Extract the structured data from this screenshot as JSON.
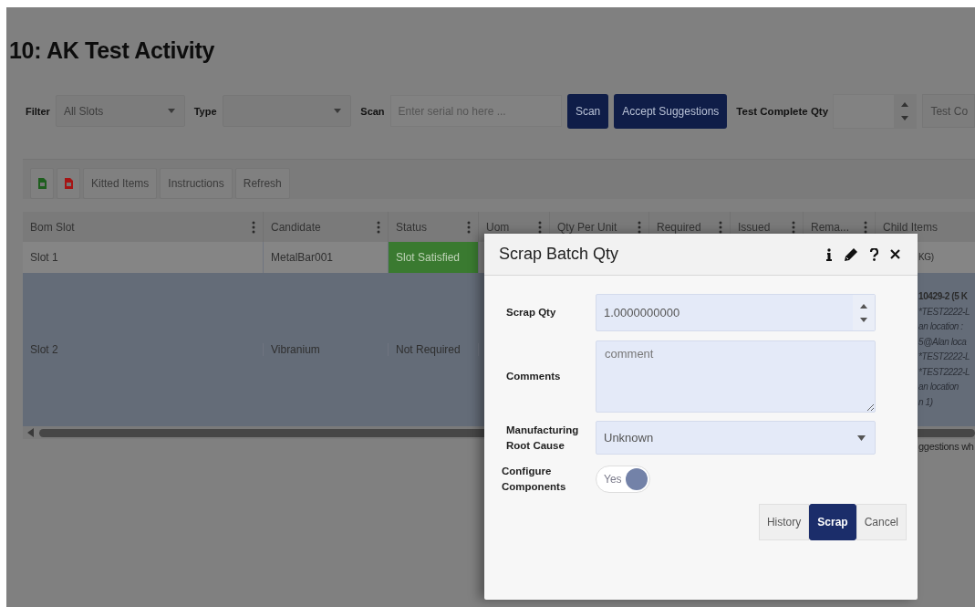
{
  "title": "10: AK Test Activity",
  "filters": [
    {
      "kind": "select",
      "label": "Filter",
      "value": "All Slots"
    },
    {
      "kind": "select",
      "label": "Type"
    },
    {
      "kind": "scan",
      "label": "Scan",
      "placeholder": "Enter serial no here ..."
    }
  ],
  "action_buttons": [
    "Scan",
    "Accept Suggestions"
  ],
  "test_complete": {
    "label": "Test Complete Qty",
    "next_field": "Test Co"
  },
  "grid_toolbar": [
    {
      "kind": "excel"
    },
    {
      "kind": "pdf"
    },
    {
      "kind": "text",
      "label": "Kitted Items"
    },
    {
      "kind": "text",
      "label": "Instructions"
    },
    {
      "kind": "text",
      "label": "Refresh"
    }
  ],
  "columns": [
    {
      "label": "Bom Slot",
      "menu": true
    },
    {
      "label": "Candidate",
      "menu": true
    },
    {
      "label": "Status",
      "menu": true
    },
    {
      "label": "Uom",
      "menu": true
    },
    {
      "label": "Qty Per Unit",
      "menu": true
    },
    {
      "label": "Required",
      "menu": true
    },
    {
      "label": "Issued",
      "menu": true
    },
    {
      "label": "Rema...",
      "menu": true
    },
    {
      "label": "Child Items"
    }
  ],
  "rows": [
    {
      "selected": false,
      "slot": "Slot 1",
      "candidate": "MetalBar001",
      "status": "Slot Satisfied",
      "satisfied": true,
      "child_items": [
        {
          "text": "KG)",
          "italic": false
        }
      ]
    },
    {
      "selected": true,
      "slot": "Slot 2",
      "candidate": "Vibranium",
      "status": "Not Required",
      "satisfied": false,
      "child_items": [
        {
          "text": "10429-2 (5 K",
          "italic": false
        },
        {
          "text": "*TEST2222-L",
          "italic": true
        },
        {
          "text": "an location :",
          "italic": true
        },
        {
          "text": "5@Alan loca",
          "italic": true
        },
        {
          "text": "*TEST2222-L",
          "italic": true
        },
        {
          "text": "*TEST2222-L",
          "italic": true
        },
        {
          "text": "an location",
          "italic": true
        },
        {
          "text": "n 1)",
          "italic": true
        }
      ]
    }
  ],
  "note": "ggestions wh",
  "modal": {
    "title": "Scrap Batch Qty",
    "header_icons": [
      {
        "kind": "info"
      },
      {
        "kind": "edit"
      },
      {
        "kind": "help"
      },
      {
        "kind": "close"
      }
    ],
    "fields": [
      {
        "kind": "number",
        "label": "Scrap Qty",
        "value": "1.0000000000"
      },
      {
        "kind": "textarea",
        "label": "Comments",
        "placeholder": "comment"
      },
      {
        "kind": "select",
        "label": "Manufacturing Root Cause",
        "value": "Unknown"
      },
      {
        "kind": "toggle",
        "label": "Configure Components",
        "on": true,
        "text": "Yes"
      }
    ],
    "buttons": [
      {
        "label": "History",
        "primary": false
      },
      {
        "label": "Scrap",
        "primary": true
      },
      {
        "label": "Cancel",
        "primary": false
      }
    ]
  }
}
